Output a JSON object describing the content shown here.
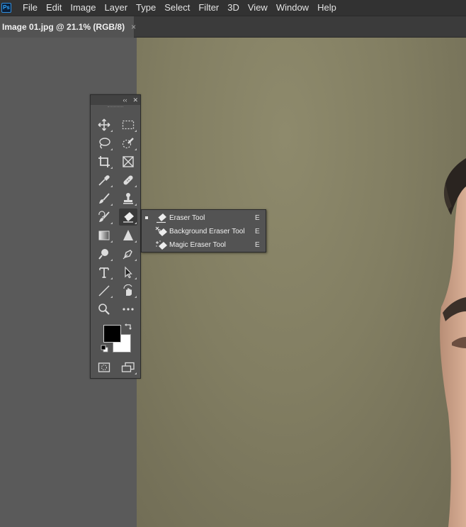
{
  "app": {
    "logo_text": "Ps"
  },
  "menu": [
    "File",
    "Edit",
    "Image",
    "Layer",
    "Type",
    "Select",
    "Filter",
    "3D",
    "View",
    "Window",
    "Help"
  ],
  "document_tab": {
    "title": "Image 01.jpg @ 21.1% (RGB/8)",
    "close_glyph": "×"
  },
  "tools_panel": {
    "collapse_glyph": "‹‹",
    "close_glyph": "✕",
    "tools": [
      {
        "name": "move-tool-icon"
      },
      {
        "name": "rectangular-marquee-tool-icon"
      },
      {
        "name": "lasso-tool-icon"
      },
      {
        "name": "quick-selection-tool-icon"
      },
      {
        "name": "crop-tool-icon"
      },
      {
        "name": "frame-tool-icon"
      },
      {
        "name": "eyedropper-tool-icon"
      },
      {
        "name": "healing-brush-tool-icon"
      },
      {
        "name": "brush-tool-icon"
      },
      {
        "name": "clone-stamp-tool-icon"
      },
      {
        "name": "history-brush-tool-icon"
      },
      {
        "name": "eraser-tool-icon",
        "active": true
      },
      {
        "name": "gradient-tool-icon"
      },
      {
        "name": "blur-tool-icon"
      },
      {
        "name": "dodge-tool-icon"
      },
      {
        "name": "pen-tool-icon"
      },
      {
        "name": "type-tool-icon"
      },
      {
        "name": "path-selection-tool-icon"
      },
      {
        "name": "line-tool-icon"
      },
      {
        "name": "rotate-view-tool-icon"
      },
      {
        "name": "zoom-tool-icon"
      },
      {
        "name": "edit-toolbar-icon"
      }
    ],
    "foreground_color": "#000000",
    "background_color": "#ffffff"
  },
  "eraser_flyout": {
    "items": [
      {
        "label": "Eraser Tool",
        "shortcut": "E",
        "selected": true,
        "icon": "eraser-icon"
      },
      {
        "label": "Background Eraser Tool",
        "shortcut": "E",
        "selected": false,
        "icon": "background-eraser-icon"
      },
      {
        "label": "Magic Eraser Tool",
        "shortcut": "E",
        "selected": false,
        "icon": "magic-eraser-icon"
      }
    ]
  },
  "colors": {
    "menubar": "#323232",
    "pasteboard": "#5a5a5a",
    "photo_backdrop": "#827e62",
    "panel": "#535353"
  }
}
